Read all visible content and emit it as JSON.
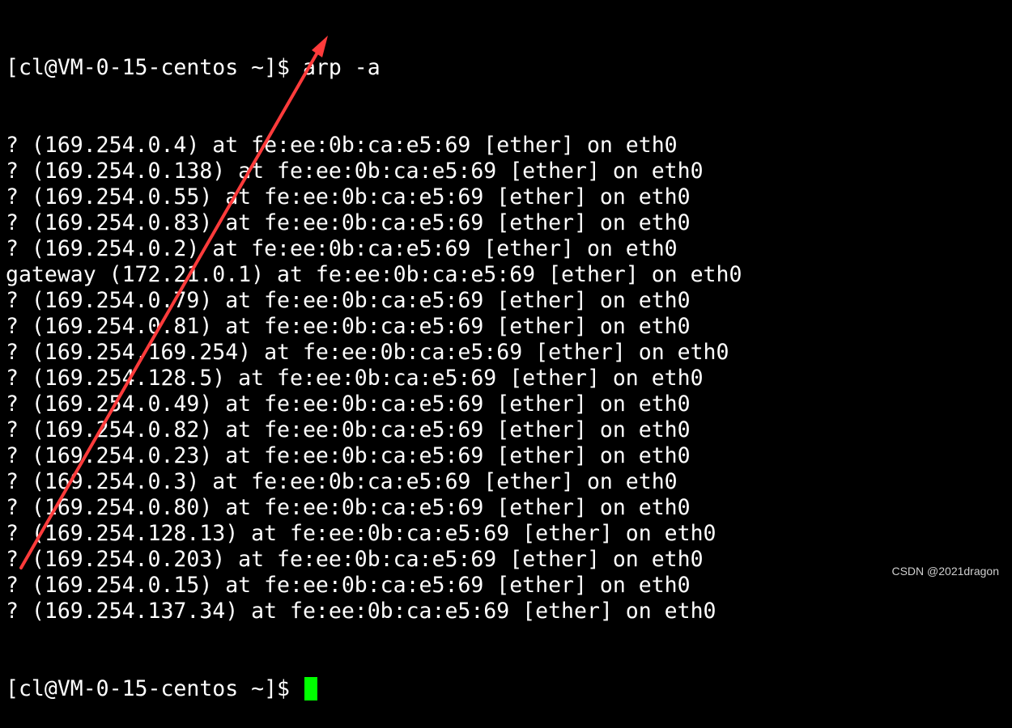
{
  "terminal": {
    "prompt_line": "[cl@VM-0-15-centos ~]$ arp -a",
    "entries": [
      "? (169.254.0.4) at fe:ee:0b:ca:e5:69 [ether] on eth0",
      "? (169.254.0.138) at fe:ee:0b:ca:e5:69 [ether] on eth0",
      "? (169.254.0.55) at fe:ee:0b:ca:e5:69 [ether] on eth0",
      "? (169.254.0.83) at fe:ee:0b:ca:e5:69 [ether] on eth0",
      "? (169.254.0.2) at fe:ee:0b:ca:e5:69 [ether] on eth0",
      "gateway (172.21.0.1) at fe:ee:0b:ca:e5:69 [ether] on eth0",
      "? (169.254.0.79) at fe:ee:0b:ca:e5:69 [ether] on eth0",
      "? (169.254.0.81) at fe:ee:0b:ca:e5:69 [ether] on eth0",
      "? (169.254.169.254) at fe:ee:0b:ca:e5:69 [ether] on eth0",
      "? (169.254.128.5) at fe:ee:0b:ca:e5:69 [ether] on eth0",
      "? (169.254.0.49) at fe:ee:0b:ca:e5:69 [ether] on eth0",
      "? (169.254.0.82) at fe:ee:0b:ca:e5:69 [ether] on eth0",
      "? (169.254.0.23) at fe:ee:0b:ca:e5:69 [ether] on eth0",
      "? (169.254.0.3) at fe:ee:0b:ca:e5:69 [ether] on eth0",
      "? (169.254.0.80) at fe:ee:0b:ca:e5:69 [ether] on eth0",
      "? (169.254.128.13) at fe:ee:0b:ca:e5:69 [ether] on eth0",
      "? (169.254.0.203) at fe:ee:0b:ca:e5:69 [ether] on eth0",
      "? (169.254.0.15) at fe:ee:0b:ca:e5:69 [ether] on eth0",
      "? (169.254.137.34) at fe:ee:0b:ca:e5:69 [ether] on eth0"
    ],
    "final_prompt": "[cl@VM-0-15-centos ~]$ ",
    "cursor_color": "#00ff00",
    "text_color": "#ffffff",
    "background_color": "#000000"
  },
  "annotation": {
    "arrow_color": "#ff3b3b"
  },
  "watermark": {
    "text": "CSDN @2021dragon"
  }
}
